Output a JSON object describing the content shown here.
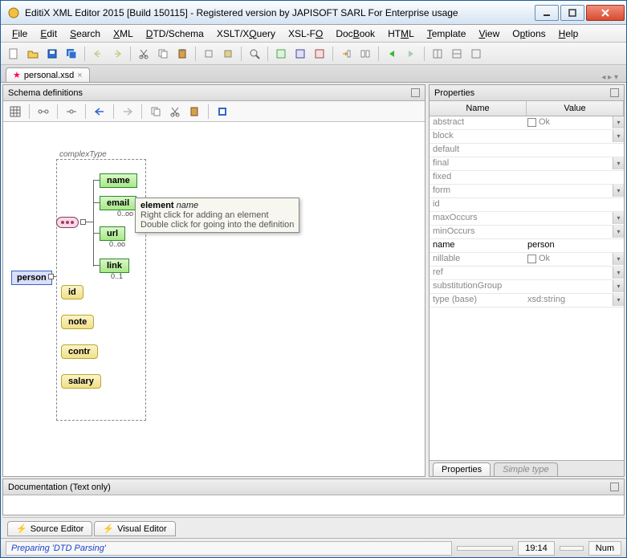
{
  "title": "EditiX XML Editor 2015 [Build 150115] - Registered version by JAPISOFT SARL For Enterprise usage",
  "menu": [
    "File",
    "Edit",
    "Search",
    "XML",
    "DTD/Schema",
    "XSLT/XQuery",
    "XSL-FO",
    "DocBook",
    "HTML",
    "Template",
    "View",
    "Options",
    "Help"
  ],
  "file_tab": "personal.xsd",
  "panels": {
    "schema_title": "Schema definitions",
    "props_title": "Properties",
    "doc_title": "Documentation (Text only)"
  },
  "root_element": "person",
  "complex_type_label": "complexType",
  "elements": [
    {
      "name": "name",
      "card": null
    },
    {
      "name": "email",
      "card": "0..oo"
    },
    {
      "name": "url",
      "card": "0..oo"
    },
    {
      "name": "link",
      "card": "0..1"
    }
  ],
  "attributes": [
    "id",
    "note",
    "contr",
    "salary"
  ],
  "tooltip": {
    "title_prefix": "element",
    "title_name": "name",
    "line1": "Right click for adding an element",
    "line2": "Double click for going into the definition"
  },
  "props_cols": {
    "name": "Name",
    "value": "Value"
  },
  "props": [
    {
      "n": "abstract",
      "v": "Ok",
      "cb": true,
      "dd": true
    },
    {
      "n": "block",
      "v": "",
      "dd": true
    },
    {
      "n": "default",
      "v": ""
    },
    {
      "n": "final",
      "v": "",
      "dd": true
    },
    {
      "n": "fixed",
      "v": ""
    },
    {
      "n": "form",
      "v": "",
      "dd": true
    },
    {
      "n": "id",
      "v": ""
    },
    {
      "n": "maxOccurs",
      "v": "",
      "dd": true
    },
    {
      "n": "minOccurs",
      "v": "",
      "dd": true
    },
    {
      "n": "name",
      "v": "person",
      "strong": true
    },
    {
      "n": "nillable",
      "v": "Ok",
      "cb": true,
      "dd": true
    },
    {
      "n": "ref",
      "v": "",
      "dd": true
    },
    {
      "n": "substitutionGroup",
      "v": "",
      "dd": true
    },
    {
      "n": "type (base)",
      "v": "xsd:string",
      "dd": true
    }
  ],
  "props_tabs": [
    "Properties",
    "Simple type"
  ],
  "bottom_tabs": [
    "Source Editor",
    "Visual Editor"
  ],
  "status": {
    "msg": "Preparing 'DTD Parsing'",
    "pos": "19:14",
    "mode": "Num"
  }
}
